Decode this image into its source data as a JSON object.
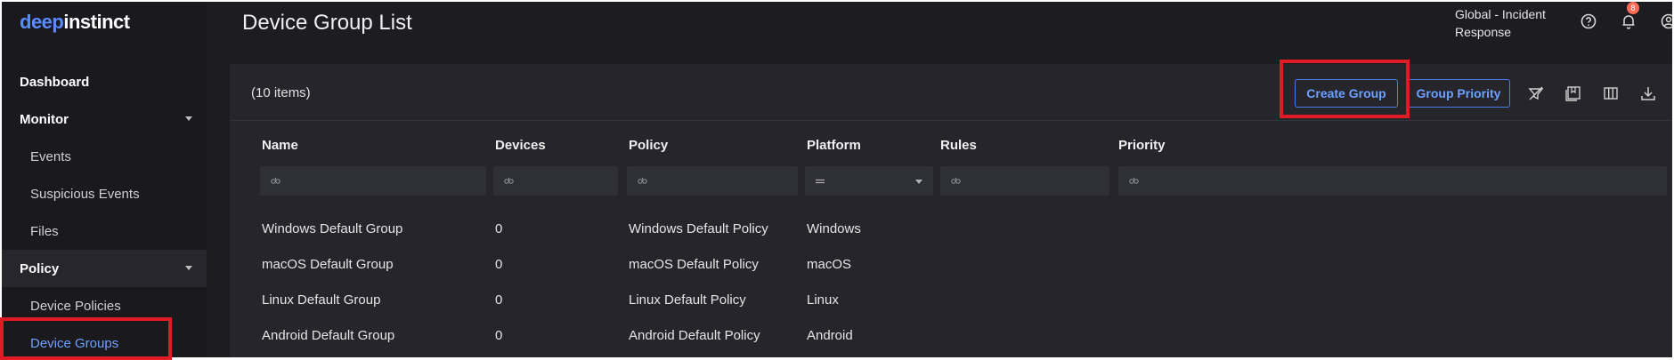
{
  "logo": {
    "part1": "deep",
    "part2": "instinct"
  },
  "page_title": "Device Group List",
  "header": {
    "tenant": "Global - Incident Response",
    "notification_count": "8"
  },
  "sidebar": {
    "items": [
      {
        "label": "Dashboard"
      },
      {
        "label": "Monitor"
      },
      {
        "label": "Events"
      },
      {
        "label": "Suspicious Events"
      },
      {
        "label": "Files"
      },
      {
        "label": "Policy"
      },
      {
        "label": "Device Policies"
      },
      {
        "label": "Device Groups"
      }
    ]
  },
  "toolbar": {
    "items_count": "(10 items)",
    "create_group_label": "Create Group",
    "group_priority_label": "Group Priority"
  },
  "table": {
    "columns": [
      "Name",
      "Devices",
      "Policy",
      "Platform",
      "Rules",
      "Priority"
    ],
    "rows": [
      [
        "Windows Default Group",
        "0",
        "Windows Default Policy",
        "Windows"
      ],
      [
        "macOS Default Group",
        "0",
        "macOS Default Policy",
        "macOS"
      ],
      [
        "Linux Default Group",
        "0",
        "Linux Default Policy",
        "Linux"
      ],
      [
        "Android Default Group",
        "0",
        "Android Default Policy",
        "Android"
      ]
    ]
  },
  "colors": {
    "accent": "#6ea0ff",
    "highlight": "#e01b24",
    "panel": "#25252b"
  }
}
